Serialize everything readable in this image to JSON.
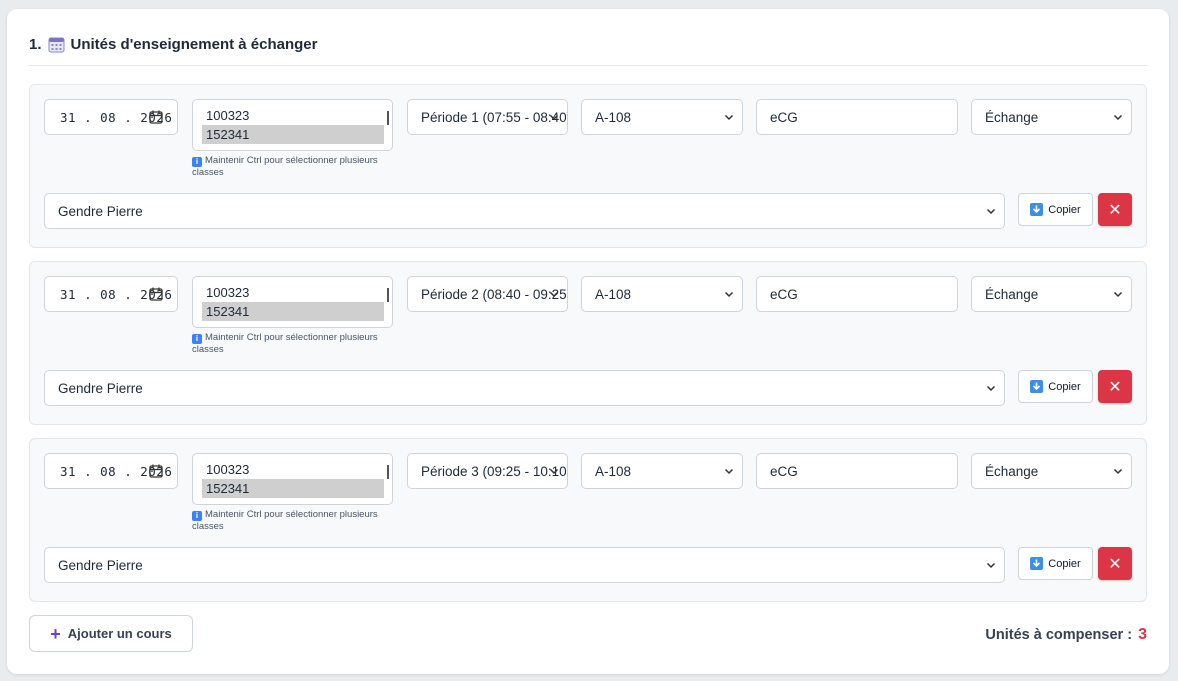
{
  "section": {
    "number": "1.",
    "icon": "calendar-icon",
    "title": "Unités d'enseignement à échanger"
  },
  "lessons": [
    {
      "date": "31 . 08 . 2026",
      "classes": [
        "100323",
        "152341"
      ],
      "selected_class": "152341",
      "class_hint": "Maintenir Ctrl pour sélectionner plusieurs classes",
      "period": "Période 1 (07:55 - 08:40)",
      "room": "A-108",
      "subject": "eCG",
      "kind": "Échange",
      "teacher": "Gendre Pierre",
      "copy_label": "Copier",
      "delete_label": "✕"
    },
    {
      "date": "31 . 08 . 2026",
      "classes": [
        "100323",
        "152341"
      ],
      "selected_class": "152341",
      "class_hint": "Maintenir Ctrl pour sélectionner plusieurs classes",
      "period": "Période 2 (08:40 - 09:25)",
      "room": "A-108",
      "subject": "eCG",
      "kind": "Échange",
      "teacher": "Gendre Pierre",
      "copy_label": "Copier",
      "delete_label": "✕"
    },
    {
      "date": "31 . 08 . 2026",
      "classes": [
        "100323",
        "152341"
      ],
      "selected_class": "152341",
      "class_hint": "Maintenir Ctrl pour sélectionner plusieurs classes",
      "period": "Période 3 (09:25 - 10:10)",
      "room": "A-108",
      "subject": "eCG",
      "kind": "Échange",
      "teacher": "Gendre Pierre",
      "copy_label": "Copier",
      "delete_label": "✕"
    }
  ],
  "add_button": {
    "label": "Ajouter un cours",
    "icon": "plus-icon"
  },
  "compensate": {
    "label": "Unités à compenser :",
    "count": "3"
  },
  "colors": {
    "danger": "#dc3545",
    "accent": "#6f42c1",
    "info": "#3b82f6"
  }
}
